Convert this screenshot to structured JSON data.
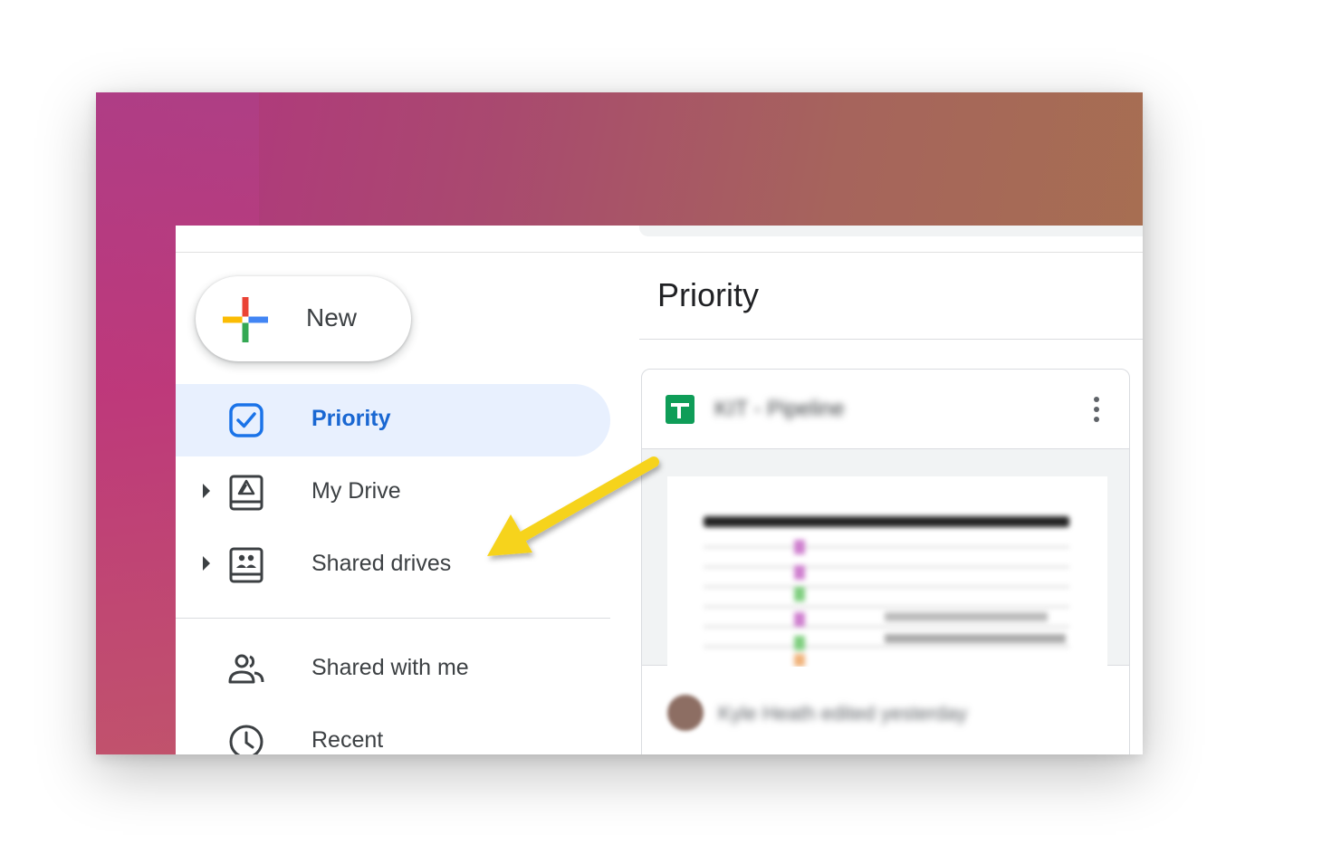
{
  "new_button": {
    "label": "New",
    "icon": "plus-icon"
  },
  "nav": {
    "items": [
      {
        "label": "Priority",
        "icon": "priority-checkbox-icon",
        "active": true,
        "expandable": false
      },
      {
        "label": "My Drive",
        "icon": "my-drive-icon",
        "active": false,
        "expandable": true
      },
      {
        "label": "Shared drives",
        "icon": "shared-drives-icon",
        "active": false,
        "expandable": true
      },
      {
        "label": "Shared with me",
        "icon": "people-icon",
        "active": false,
        "expandable": false
      },
      {
        "label": "Recent",
        "icon": "clock-icon",
        "active": false,
        "expandable": false
      }
    ]
  },
  "main": {
    "title": "Priority",
    "card": {
      "file_name": "KIT - Pipeline",
      "file_type_icon": "google-sheets-icon",
      "menu_icon": "more-vert-icon",
      "activity": "Kyle Heath edited yesterday"
    }
  },
  "annotation": {
    "icon": "yellow-arrow-icon",
    "color": "#f6d31a"
  },
  "colors": {
    "active_bg": "#e8f0fe",
    "active_text": "#1967d2",
    "sheets_green": "#0f9d58"
  }
}
